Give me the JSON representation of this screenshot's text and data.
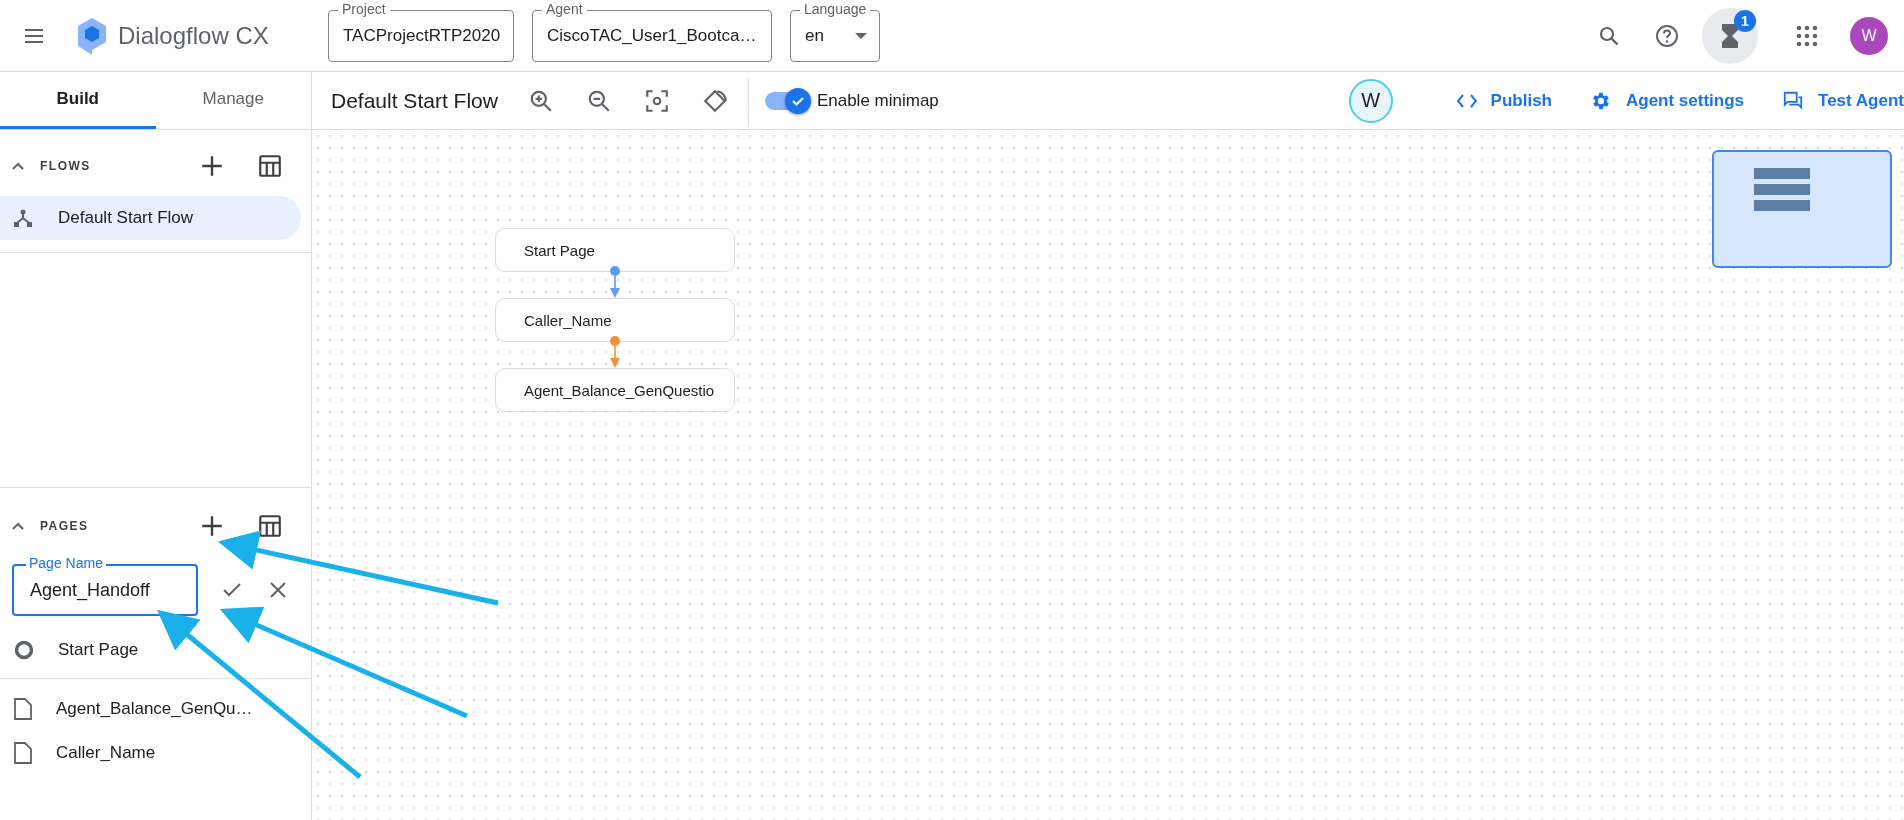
{
  "header": {
    "app_title": "Dialogflow CX",
    "selectors": [
      {
        "label": "Project",
        "value": "TACProjectRTP2020"
      },
      {
        "label": "Agent",
        "value": "CiscoTAC_User1_Bootca…"
      },
      {
        "label": "Language",
        "value": "en"
      }
    ],
    "notification_count": "1",
    "avatar_initial": "W"
  },
  "sidebar": {
    "tabs": [
      {
        "label": "Build",
        "selected": true
      },
      {
        "label": "Manage",
        "selected": false
      }
    ],
    "flows": {
      "title": "FLOWS",
      "items": [
        {
          "label": "Default Start Flow",
          "selected": true
        }
      ]
    },
    "pages": {
      "title": "PAGES",
      "new_page_field": {
        "label": "Page Name",
        "value": "Agent_Handoff"
      },
      "items": [
        {
          "label": "Start Page",
          "kind": "start"
        },
        {
          "label": "Agent_Balance_GenQu…",
          "kind": "page"
        },
        {
          "label": "Caller_Name",
          "kind": "page"
        }
      ]
    }
  },
  "toolbar": {
    "flow_title": "Default Start Flow",
    "minimap_toggle": {
      "label": "Enable minimap",
      "on": true
    },
    "collaborator_initial": "W",
    "actions": [
      {
        "label": "Publish",
        "kind": "code"
      },
      {
        "label": "Agent settings",
        "kind": "gear"
      },
      {
        "label": "Test Agent",
        "kind": "chat"
      }
    ]
  },
  "canvas": {
    "nodes": [
      {
        "label": "Start Page"
      },
      {
        "label": "Caller_Name"
      },
      {
        "label": "Agent_Balance_GenQuestio"
      }
    ],
    "edges": [
      {
        "color": "#5b9cf6"
      },
      {
        "color": "#f4923b"
      }
    ]
  }
}
